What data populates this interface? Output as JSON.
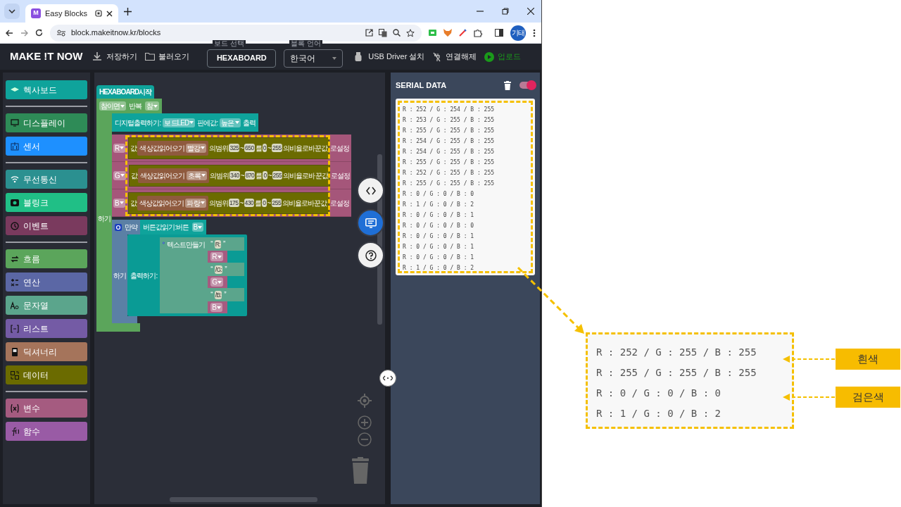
{
  "browser": {
    "tab": {
      "favicon": "M",
      "title": "Easy Blocks"
    },
    "url": "block.makeitnow.kr/blocks",
    "profile": "기태"
  },
  "app_bar": {
    "logo": "MAKE !T NOW",
    "file_actions": [
      {
        "kind": "download",
        "label": "저장하기"
      },
      {
        "kind": "folder",
        "label": "불러오기"
      }
    ],
    "board": {
      "legend": "보드 선택",
      "value": "HEXABOARD"
    },
    "language": {
      "legend": "블록 언어",
      "value": "한국어"
    },
    "actions": [
      {
        "kind": "usb",
        "label": "USB Driver 설치"
      },
      {
        "kind": "unplug",
        "label": "연결해제"
      },
      {
        "kind": "upload",
        "label": "업로드"
      }
    ]
  },
  "toolbox": {
    "groups": [
      [
        {
          "kind": "board",
          "label": "헥사보드",
          "color": "#0fa39b"
        }
      ],
      [
        {
          "kind": "display",
          "label": "디스플레이",
          "color": "#2e8b57"
        },
        {
          "kind": "sensor",
          "label": "센서",
          "color": "#1e90ff"
        }
      ],
      [
        {
          "kind": "wireless",
          "label": "무선통신",
          "color": "#2b9090"
        },
        {
          "kind": "blink",
          "label": "블링크",
          "color": "#20bf86"
        },
        {
          "kind": "event",
          "label": "이벤트",
          "color": "#7a3a5e"
        }
      ],
      [
        {
          "kind": "loop",
          "label": "흐름",
          "color": "#5ba55b"
        },
        {
          "kind": "math",
          "label": "연산",
          "color": "#5b67a5"
        },
        {
          "kind": "text",
          "label": "문자열",
          "color": "#5ba58c"
        },
        {
          "kind": "list",
          "label": "리스트",
          "color": "#745ba5"
        },
        {
          "kind": "dictionary",
          "label": "딕셔너리",
          "color": "#a5745b"
        },
        {
          "kind": "data",
          "label": "데이터",
          "color": "#6b6b00"
        }
      ],
      [
        {
          "kind": "variable",
          "label": "변수",
          "color": "#a55b80"
        },
        {
          "kind": "function",
          "label": "함수",
          "color": "#995ba5"
        }
      ]
    ]
  },
  "workspace": {
    "start": {
      "label": "HEXABOARD 시작"
    },
    "loop": {
      "header": [
        {
          "kind": "dropdown",
          "text": "참이면"
        },
        {
          "kind": "text",
          "text": "반복"
        },
        {
          "kind": "dropdown",
          "text": "참"
        }
      ],
      "body_label": "하기"
    },
    "digital_write": [
      {
        "kind": "text",
        "text": "디지털 출력하기:"
      },
      {
        "kind": "dropdown",
        "text": "보드 LED"
      },
      {
        "kind": "text",
        "text": "핀에 값:"
      },
      {
        "kind": "dropdown",
        "text": "높은"
      },
      {
        "kind": "text",
        "text": "출력"
      }
    ],
    "set_rows": [
      {
        "variable": "R",
        "value_label": "값",
        "sensor": "색상값 읽어오기",
        "channel": "빨강",
        "range_label": "의 범위",
        "in_min": "325",
        "in_sep": "~",
        "in_max": "650",
        "map_label": "를",
        "out_min": "0",
        "out_sep": "~",
        "out_max": "255",
        "result_label": "의 비율로 바꾼 값",
        "set_label": "로 설정"
      },
      {
        "variable": "G",
        "value_label": "값",
        "sensor": "색상값 읽어오기",
        "channel": "초록",
        "range_label": "의 범위",
        "in_min": "340",
        "in_sep": "~",
        "in_max": "870",
        "map_label": "를",
        "out_min": "0",
        "out_sep": "~",
        "out_max": "255",
        "result_label": "의 비율로 바꾼 값",
        "set_label": "로 설정"
      },
      {
        "variable": "B",
        "value_label": "값",
        "sensor": "색상값 읽어오기",
        "channel": "파랑",
        "range_label": "의 범위",
        "in_min": "175",
        "in_sep": "~",
        "in_max": "430",
        "map_label": "를",
        "out_min": "0",
        "out_sep": "~",
        "out_max": "255",
        "result_label": "의 비율로 바꾼 값",
        "set_label": "로 설정"
      }
    ],
    "condition_block": {
      "label": "만약",
      "condition": "버튼값 읽기: 버튼",
      "button": "B",
      "body_label": "하기"
    },
    "print_block": {
      "label": "출력하기:",
      "join_label": "텍스트 만들기",
      "items": [
        {
          "kind": "string",
          "open": "“",
          "text": "R :",
          "close": "”"
        },
        {
          "kind": "variable",
          "text": "R"
        },
        {
          "kind": "string",
          "open": "“",
          "text": "/ G :",
          "close": "”"
        },
        {
          "kind": "variable",
          "text": "G"
        },
        {
          "kind": "string",
          "open": "“",
          "text": "/ B :",
          "close": "”"
        },
        {
          "kind": "variable",
          "text": "B"
        }
      ]
    }
  },
  "side_buttons": [
    {
      "kind": "code",
      "selected": false
    },
    {
      "kind": "monitor",
      "selected": true
    },
    {
      "kind": "help",
      "selected": false
    }
  ],
  "serial": {
    "title": "SERIAL DATA",
    "on": true,
    "lines": [
      "R : 252 / G : 254 / B : 255",
      "R : 253 / G : 255 / B : 255",
      "R : 255 / G : 255 / B : 255",
      "R : 254 / G : 255 / B : 255",
      "R : 254 / G : 255 / B : 255",
      "R : 255 / G : 255 / B : 255",
      "R : 252 / G : 255 / B : 255",
      "R : 255 / G : 255 / B : 255",
      "R : 0 / G : 0 / B : 0",
      "R : 1 / G : 0 / B : 2",
      "R : 0 / G : 0 / B : 1",
      "R : 0 / G : 0 / B : 0",
      "R : 0 / G : 0 / B : 1",
      "R : 0 / G : 0 / B : 1",
      "R : 0 / G : 0 / B : 1",
      "R : 1 / G : 0 / B : 2"
    ]
  },
  "annotation": {
    "lines": [
      "R : 252 / G : 255 / B : 255",
      "R : 255 / G : 255 / B : 255",
      "R : 0 / G : 0 / B : 0",
      "R : 1 / G : 0 / B : 2"
    ],
    "labels": [
      {
        "text": "흰색"
      },
      {
        "text": "검은색"
      }
    ]
  }
}
